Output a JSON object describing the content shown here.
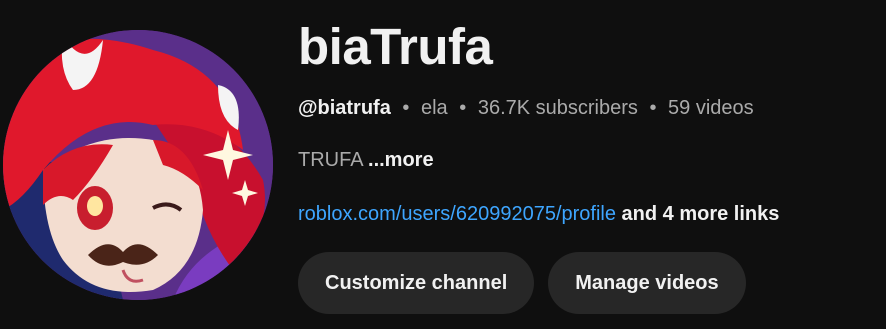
{
  "channel": {
    "name": "biaTrufa",
    "handle": "@biatrufa",
    "separator": "•",
    "pronouns": "ela",
    "subscribers": "36.7K subscribers",
    "videos": "59 videos",
    "description": "TRUFA",
    "description_more": "...more",
    "link": "roblox.com/users/620992075/profile",
    "more_links": "and 4 more links"
  },
  "buttons": {
    "customize": "Customize channel",
    "manage": "Manage videos"
  },
  "colors": {
    "background": "#0f0f0f",
    "text": "#f1f1f1",
    "muted": "#aaaaaa",
    "link": "#3ea6ff",
    "button": "#272727",
    "avatar_hair": "#d8182a",
    "avatar_bg": "#6a2a8a"
  },
  "avatar_icon": "avatar-cartoon-red-hair"
}
